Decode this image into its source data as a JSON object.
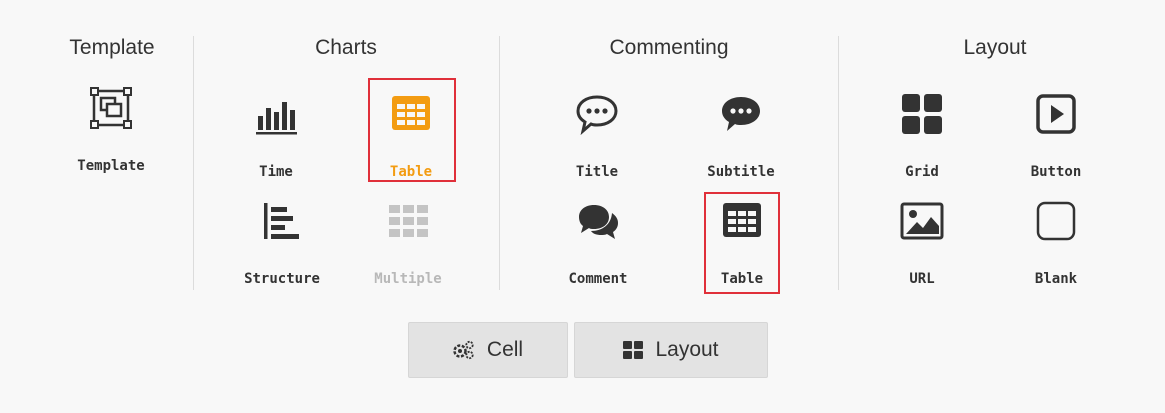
{
  "sections": {
    "template": "Template",
    "charts": "Charts",
    "commenting": "Commenting",
    "layout": "Layout"
  },
  "tools": {
    "template": "Template",
    "time": "Time",
    "chart_table": "Table",
    "structure": "Structure",
    "multiple": "Multiple",
    "title": "Title",
    "subtitle": "Subtitle",
    "comment": "Comment",
    "comment_table": "Table",
    "grid": "Grid",
    "button": "Button",
    "url": "URL",
    "blank": "Blank"
  },
  "bottom_buttons": {
    "cell": "Cell",
    "layout": "Layout"
  },
  "icons": {
    "template": "template-frame-icon",
    "time": "bar-chart-icon",
    "chart_table": "table-icon",
    "structure": "align-left-bars-icon",
    "multiple": "multi-grid-icon",
    "title": "speech-bubble-outline-icon",
    "subtitle": "speech-bubble-filled-icon",
    "comment": "comments-icon",
    "comment_table": "table-icon",
    "grid": "grid-icon",
    "button": "play-button-icon",
    "url": "image-icon",
    "blank": "blank-square-icon",
    "cell_button": "gears-icon",
    "layout_button": "th-large-icon"
  },
  "colors": {
    "background": "#f8f8f8",
    "text": "#333333",
    "accent": "#f39c12",
    "disabled": "#b8b8b8",
    "highlight_border": "#e0303a",
    "button_bg": "#e3e3e3",
    "divider": "#dcdcdc"
  },
  "state": {
    "active_tool": "chart_table",
    "disabled_tools": [
      "multiple"
    ],
    "highlighted_tools": [
      "chart_table",
      "comment_table"
    ]
  }
}
